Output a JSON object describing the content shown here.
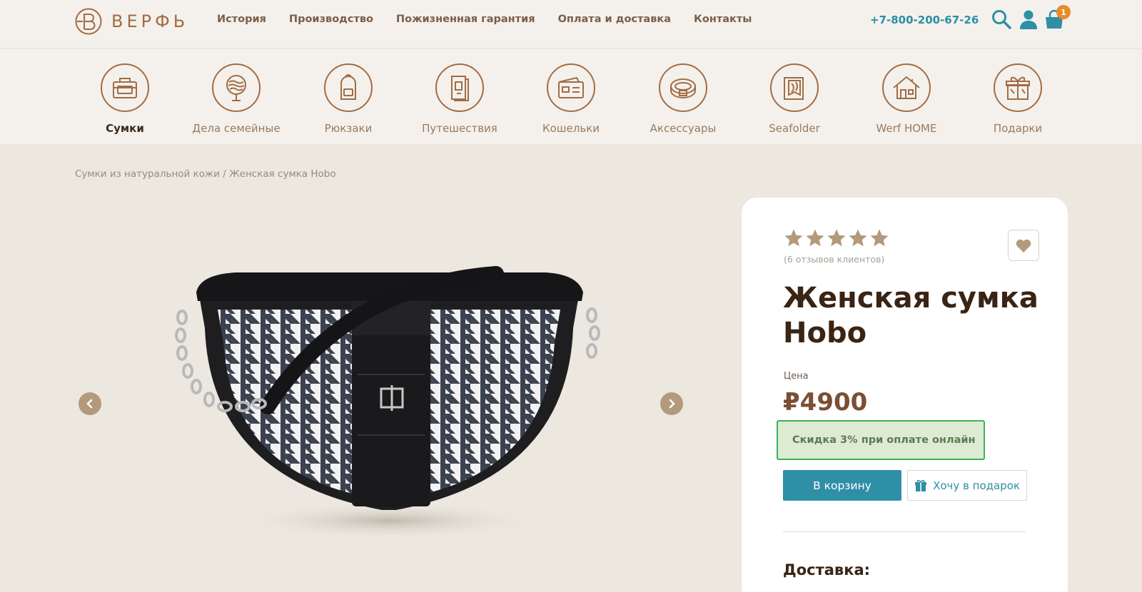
{
  "header": {
    "logo_text": "ВЕРФЬ",
    "nav": [
      "История",
      "Производство",
      "Пожизненная гарантия",
      "Оплата и доставка",
      "Контакты"
    ],
    "phone": "+7-800-200-67-26",
    "cart_count": "1"
  },
  "categories": [
    {
      "label": "Сумки",
      "icon": "bag-icon",
      "active": true
    },
    {
      "label": "Дела семейные",
      "icon": "family-tree-icon",
      "active": false
    },
    {
      "label": "Рюкзаки",
      "icon": "backpack-icon",
      "active": false
    },
    {
      "label": "Путешествия",
      "icon": "passport-icon",
      "active": false
    },
    {
      "label": "Кошельки",
      "icon": "wallet-icon",
      "active": false
    },
    {
      "label": "Аксессуары",
      "icon": "belt-icon",
      "active": false
    },
    {
      "label": "Seafolder",
      "icon": "folder-icon",
      "active": false
    },
    {
      "label": "Werf HOME",
      "icon": "house-icon",
      "active": false
    },
    {
      "label": "Подарки",
      "icon": "gift-icon",
      "active": false
    }
  ],
  "breadcrumb": {
    "parent": "Сумки из натуральной кожи",
    "separator": " / ",
    "current": "Женская сумка Hobo"
  },
  "product": {
    "rating": 5,
    "reviews": "(6 отзывов клиентов)",
    "title": "Женская сумка Hobo",
    "price_label": "Цена",
    "price": "₽4900",
    "discount": "Скидка 3% при оплате онлайн",
    "cart_button": "В корзину",
    "gift_button": "Хочу в подарок",
    "delivery_heading": "Доставка:"
  },
  "colors": {
    "brand_brown": "#a26c44",
    "accent_teal": "#2e8fa6",
    "badge_orange": "#e98a2d",
    "star": "#b39a7c",
    "discount_border": "#3eb05a"
  }
}
